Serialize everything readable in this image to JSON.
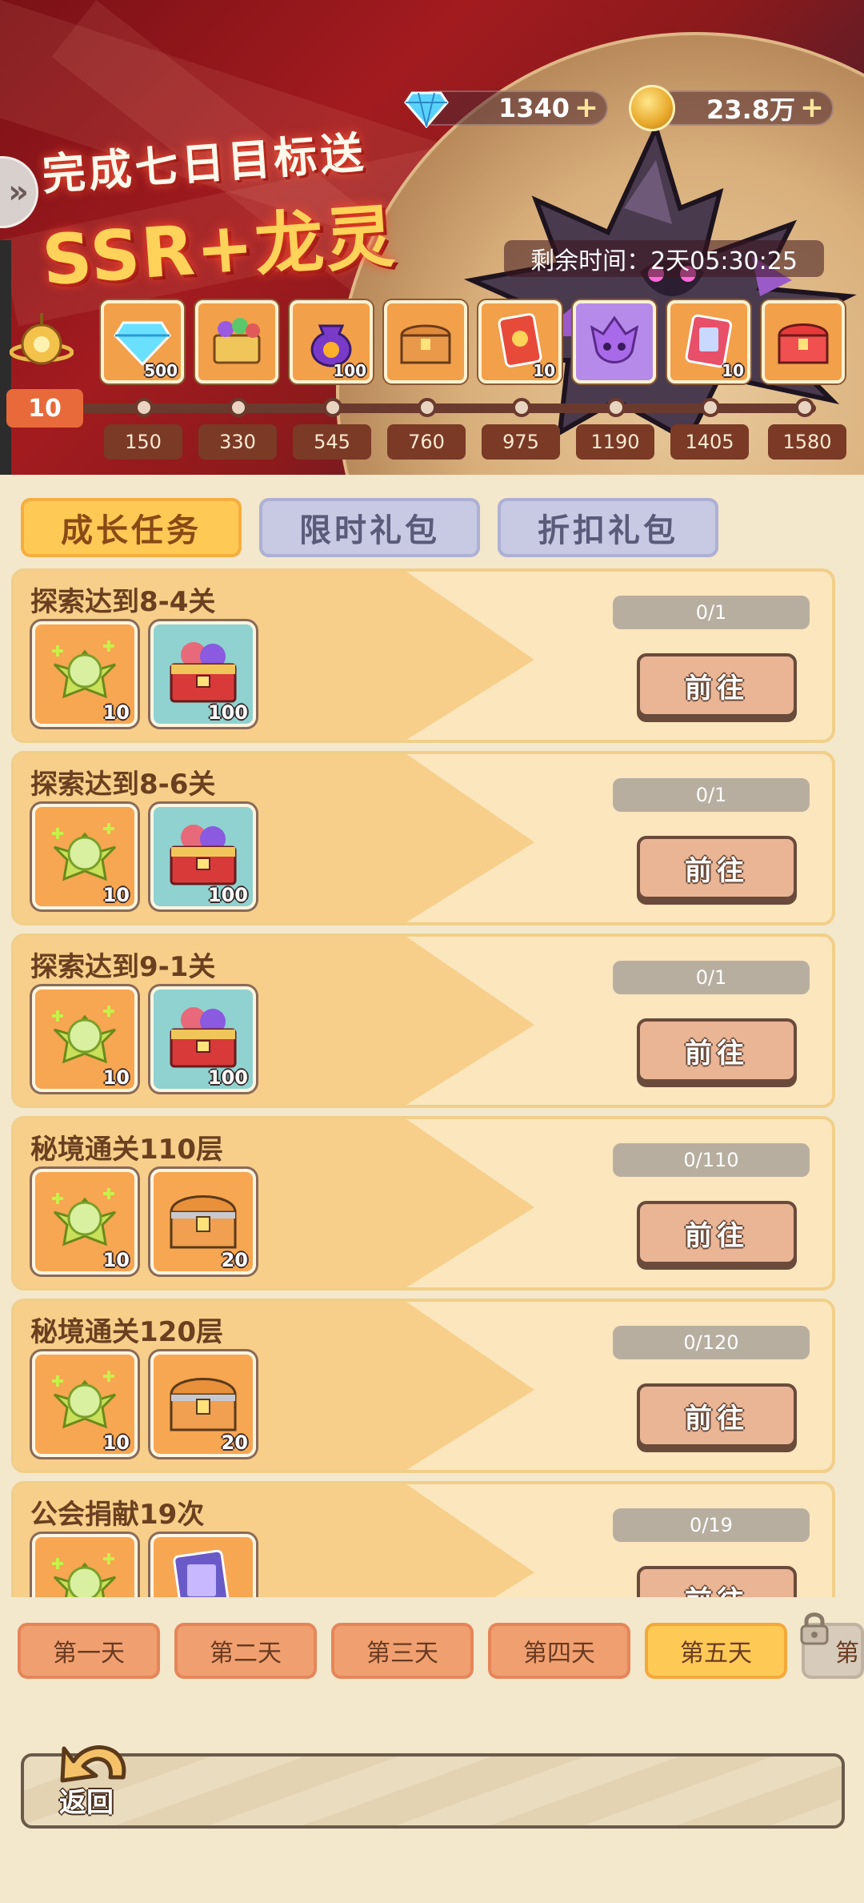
{
  "banner": {
    "title_line1": "完成七日目标送",
    "title_line2": "SSR+龙灵",
    "timer_label": "剩余时间：2天05:30:25"
  },
  "currency": {
    "gems": "1340",
    "coins": "23.8万",
    "plus": "+"
  },
  "progress": {
    "level": "10",
    "rewards": [
      {
        "icon": "diamond-icon",
        "count": "500"
      },
      {
        "icon": "gift-chest-icon",
        "count": ""
      },
      {
        "icon": "purple-bag-icon",
        "count": "100"
      },
      {
        "icon": "treasure-chest-icon",
        "count": ""
      },
      {
        "icon": "red-ticket-icon",
        "count": "10"
      },
      {
        "icon": "purple-dragon-spirit-icon",
        "count": ""
      },
      {
        "icon": "card-ticket-icon",
        "count": "10"
      },
      {
        "icon": "red-chest-icon",
        "count": ""
      }
    ],
    "milestones": [
      "150",
      "330",
      "545",
      "760",
      "975",
      "1190",
      "1405",
      "1580"
    ]
  },
  "tabs": [
    "成长任务",
    "限时礼包",
    "折扣礼包"
  ],
  "tasks": [
    {
      "name": "探索达到8-4关",
      "progress": "0/1",
      "button": "前往",
      "items": [
        {
          "type": "green-orb",
          "count": "10"
        },
        {
          "type": "fruit-chest",
          "count": "100"
        }
      ]
    },
    {
      "name": "探索达到8-6关",
      "progress": "0/1",
      "button": "前往",
      "items": [
        {
          "type": "green-orb",
          "count": "10"
        },
        {
          "type": "fruit-chest",
          "count": "100"
        }
      ]
    },
    {
      "name": "探索达到9-1关",
      "progress": "0/1",
      "button": "前往",
      "items": [
        {
          "type": "green-orb",
          "count": "10"
        },
        {
          "type": "fruit-chest",
          "count": "100"
        }
      ]
    },
    {
      "name": "秘境通关110层",
      "progress": "0/110",
      "button": "前往",
      "items": [
        {
          "type": "green-orb",
          "count": "10"
        },
        {
          "type": "treasure-chest",
          "count": "20"
        }
      ]
    },
    {
      "name": "秘境通关120层",
      "progress": "0/120",
      "button": "前往",
      "items": [
        {
          "type": "green-orb",
          "count": "10"
        },
        {
          "type": "treasure-chest",
          "count": "20"
        }
      ]
    },
    {
      "name": "公会捐献19次",
      "progress": "0/19",
      "button": "前往",
      "items": [
        {
          "type": "green-orb",
          "count": ""
        },
        {
          "type": "card-ticket",
          "count": ""
        }
      ]
    }
  ],
  "days": [
    "第一天",
    "第二天",
    "第三天",
    "第四天",
    "第五天",
    "第"
  ],
  "active_day": 4,
  "back_label": "返回",
  "colors": {
    "banner_red": "#a21b1f",
    "tab_active": "#ffc956",
    "tab_inactive": "#c8c9e2",
    "task_bg": "#fbe6bd",
    "go_button": "#e9b595",
    "level_badge": "#e86a3a"
  }
}
